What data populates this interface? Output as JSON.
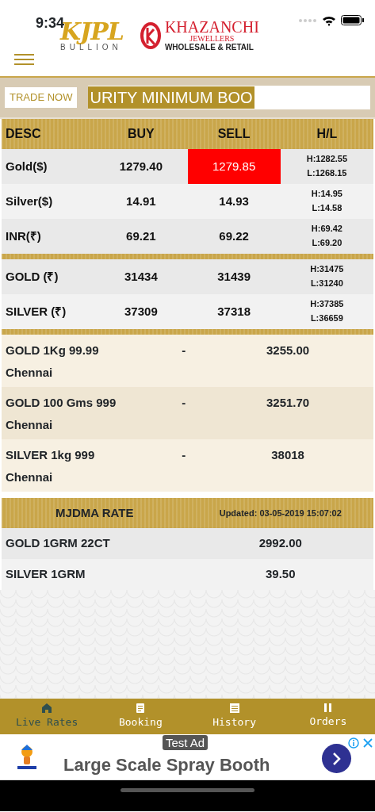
{
  "status_bar": {
    "time": "9:34"
  },
  "header": {
    "logo_left": {
      "title": "KJPL",
      "subtitle": "BULLION"
    },
    "logo_right": {
      "title": "KHAZANCHI",
      "line2": "JEWELLERS",
      "line3": "WHOLESALE & RETAIL"
    }
  },
  "trade_bar": {
    "button": "TRADE NOW",
    "ticker": "URITY MINIMUM BOO"
  },
  "rates_table": {
    "columns": [
      "DESC",
      "BUY",
      "SELL",
      "H/L"
    ],
    "groups": [
      [
        {
          "desc": "Gold($)",
          "buy": "1279.40",
          "sell": "1279.85",
          "high": "H:1282.55",
          "low": "L:1268.15",
          "sell_highlighted": true
        },
        {
          "desc": "Silver($)",
          "buy": "14.91",
          "sell": "14.93",
          "high": "H:14.95",
          "low": "L:14.58",
          "sell_highlighted": false
        },
        {
          "desc": "INR(₹)",
          "buy": "69.21",
          "sell": "69.22",
          "high": "H:69.42",
          "low": "L:69.20",
          "sell_highlighted": false
        }
      ],
      [
        {
          "desc": "GOLD (₹)",
          "buy": "31434",
          "sell": "31439",
          "high": "H:31475",
          "low": "L:31240",
          "sell_highlighted": false
        },
        {
          "desc": "SILVER (₹)",
          "buy": "37309",
          "sell": "37318",
          "high": "H:37385",
          "low": "L:36659",
          "sell_highlighted": false
        }
      ]
    ]
  },
  "chennai_rates": [
    {
      "desc": "GOLD 1Kg 99.99 Chennai",
      "buy": "-",
      "sell": "3255.00"
    },
    {
      "desc": "GOLD 100 Gms 999 Chennai",
      "buy": "-",
      "sell": "3251.70"
    },
    {
      "desc": "SILVER 1kg 999 Chennai",
      "buy": "-",
      "sell": "38018"
    }
  ],
  "mjdma": {
    "title": "MJDMA RATE",
    "updated": "Updated: 03-05-2019 15:07:02",
    "rows": [
      {
        "desc": "GOLD 1GRM 22CT",
        "rate": "2992.00"
      },
      {
        "desc": "SILVER 1GRM",
        "rate": "39.50"
      }
    ]
  },
  "bottom_nav": [
    {
      "label": "Live Rates",
      "selected": true
    },
    {
      "label": "Booking",
      "selected": false
    },
    {
      "label": "History",
      "selected": false
    },
    {
      "label": "Orders",
      "selected": false
    }
  ],
  "ad": {
    "badge": "Test Ad",
    "text": "Large Scale Spray Booth"
  }
}
